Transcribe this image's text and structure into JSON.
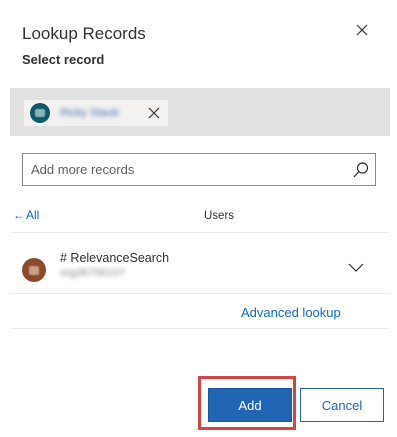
{
  "dialog": {
    "title": "Lookup Records",
    "subtitle": "Select record"
  },
  "selected": {
    "chip_name": "Ricky Staub"
  },
  "search": {
    "placeholder": "Add more records",
    "value": ""
  },
  "list": {
    "back_label": "All",
    "header": "Users",
    "items": [
      {
        "name": "# RelevanceSearch",
        "secondary": "org3675610?"
      }
    ]
  },
  "advanced_lookup_label": "Advanced lookup",
  "buttons": {
    "add": "Add",
    "cancel": "Cancel"
  },
  "colors": {
    "accent": "#2266b3",
    "link": "#0f6cbd",
    "highlight": "#d64545",
    "selected_bg": "#e1e1e1"
  },
  "icons": {
    "close": "close-icon",
    "remove": "close-icon",
    "search": "search-icon",
    "back": "arrow-left-icon",
    "expand": "chevron-down-icon"
  }
}
